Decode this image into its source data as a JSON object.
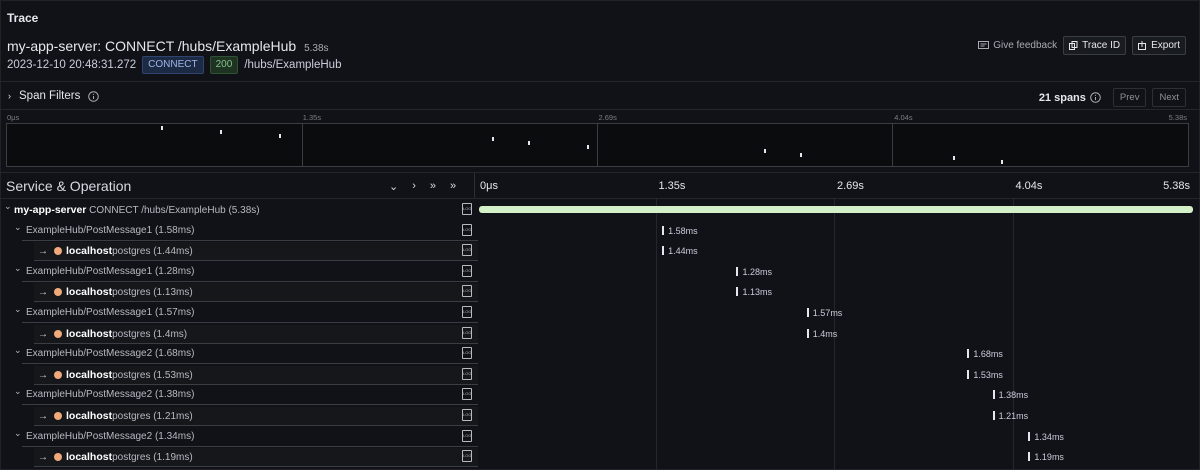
{
  "panel": {
    "title": "Trace"
  },
  "trace": {
    "title": "my-app-server: CONNECT /hubs/ExampleHub",
    "duration": "5.38s",
    "timestamp": "2023-12-10 20:48:31.272",
    "method": "CONNECT",
    "status": "200",
    "path": "/hubs/ExampleHub"
  },
  "actions": {
    "feedback": "Give feedback",
    "trace_id": "Trace ID",
    "export": "Export"
  },
  "filters": {
    "label": "Span Filters",
    "spans_count": "21 spans",
    "prev": "Prev",
    "next": "Next"
  },
  "minimap": {
    "ticks": [
      "0μs",
      "1.35s",
      "2.69s",
      "4.04s",
      "5.38s"
    ],
    "markers": [
      {
        "t": 0.13,
        "row": 0
      },
      {
        "t": 0.18,
        "row": 1
      },
      {
        "t": 0.23,
        "row": 2
      },
      {
        "t": 0.41,
        "row": 3
      },
      {
        "t": 0.44,
        "row": 4
      },
      {
        "t": 0.49,
        "row": 5
      },
      {
        "t": 0.64,
        "row": 6
      },
      {
        "t": 0.67,
        "row": 7
      },
      {
        "t": 0.8,
        "row": 8
      },
      {
        "t": 0.84,
        "row": 9
      }
    ]
  },
  "timeline": {
    "header": "Service & Operation",
    "ticks": [
      "0μs",
      "1.35s",
      "2.69s",
      "4.04s",
      "5.38s"
    ],
    "total_s": 5.38
  },
  "colors": {
    "root_bar": "#d4f0c8",
    "service_dot": "#f0a97a"
  },
  "spans": [
    {
      "service": "my-app-server",
      "operation": "CONNECT /hubs/ExampleHub (5.38s)",
      "depth": 0,
      "root": true,
      "start_s": 0,
      "duration": "5.38s"
    },
    {
      "service": "",
      "operation": "ExampleHub/PostMessage1 (1.58ms)",
      "depth": 1,
      "start_s": 1.38,
      "duration": "1.58ms"
    },
    {
      "service": "localhost",
      "operation": "postgres (1.44ms)",
      "depth": 2,
      "start_s": 1.38,
      "duration": "1.44ms"
    },
    {
      "service": "",
      "operation": "ExampleHub/PostMessage1 (1.28ms)",
      "depth": 1,
      "start_s": 1.94,
      "duration": "1.28ms"
    },
    {
      "service": "localhost",
      "operation": "postgres (1.13ms)",
      "depth": 2,
      "start_s": 1.94,
      "duration": "1.13ms"
    },
    {
      "service": "",
      "operation": "ExampleHub/PostMessage1 (1.57ms)",
      "depth": 1,
      "start_s": 2.47,
      "duration": "1.57ms"
    },
    {
      "service": "localhost",
      "operation": "postgres (1.4ms)",
      "depth": 2,
      "start_s": 2.47,
      "duration": "1.4ms"
    },
    {
      "service": "",
      "operation": "ExampleHub/PostMessage2 (1.68ms)",
      "depth": 1,
      "start_s": 3.68,
      "duration": "1.68ms"
    },
    {
      "service": "localhost",
      "operation": "postgres (1.53ms)",
      "depth": 2,
      "start_s": 3.68,
      "duration": "1.53ms"
    },
    {
      "service": "",
      "operation": "ExampleHub/PostMessage2 (1.38ms)",
      "depth": 1,
      "start_s": 3.87,
      "duration": "1.38ms"
    },
    {
      "service": "localhost",
      "operation": "postgres (1.21ms)",
      "depth": 2,
      "start_s": 3.87,
      "duration": "1.21ms"
    },
    {
      "service": "",
      "operation": "ExampleHub/PostMessage2 (1.34ms)",
      "depth": 1,
      "start_s": 4.14,
      "duration": "1.34ms"
    },
    {
      "service": "localhost",
      "operation": "postgres (1.19ms)",
      "depth": 2,
      "start_s": 4.14,
      "duration": "1.19ms"
    }
  ]
}
